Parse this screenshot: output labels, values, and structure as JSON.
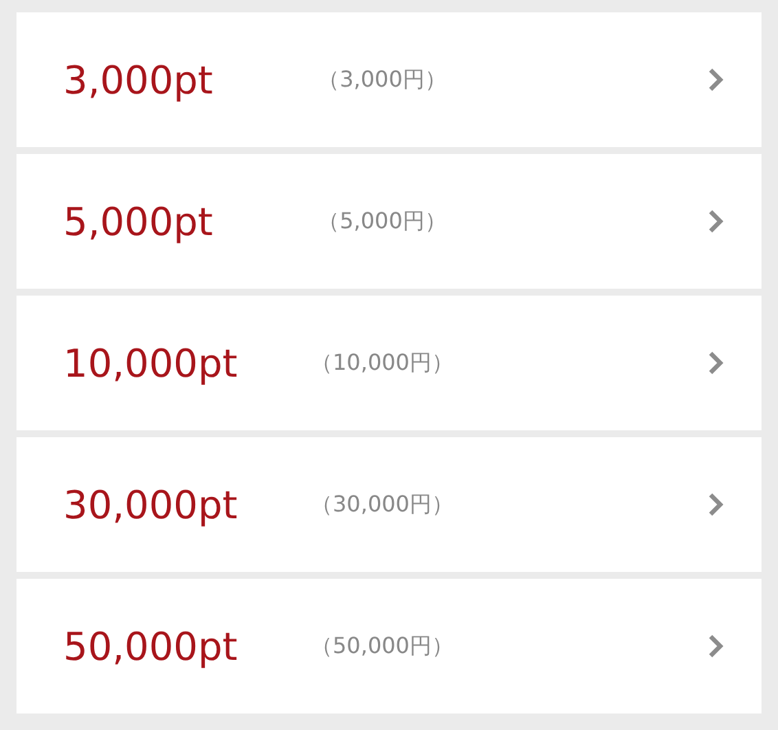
{
  "options": [
    {
      "points": "3,000pt",
      "price": "（3,000円）"
    },
    {
      "points": "5,000pt",
      "price": "（5,000円）"
    },
    {
      "points": "10,000pt",
      "price": "（10,000円）"
    },
    {
      "points": "30,000pt",
      "price": "（30,000円）"
    },
    {
      "points": "50,000pt",
      "price": "（50,000円）"
    }
  ]
}
